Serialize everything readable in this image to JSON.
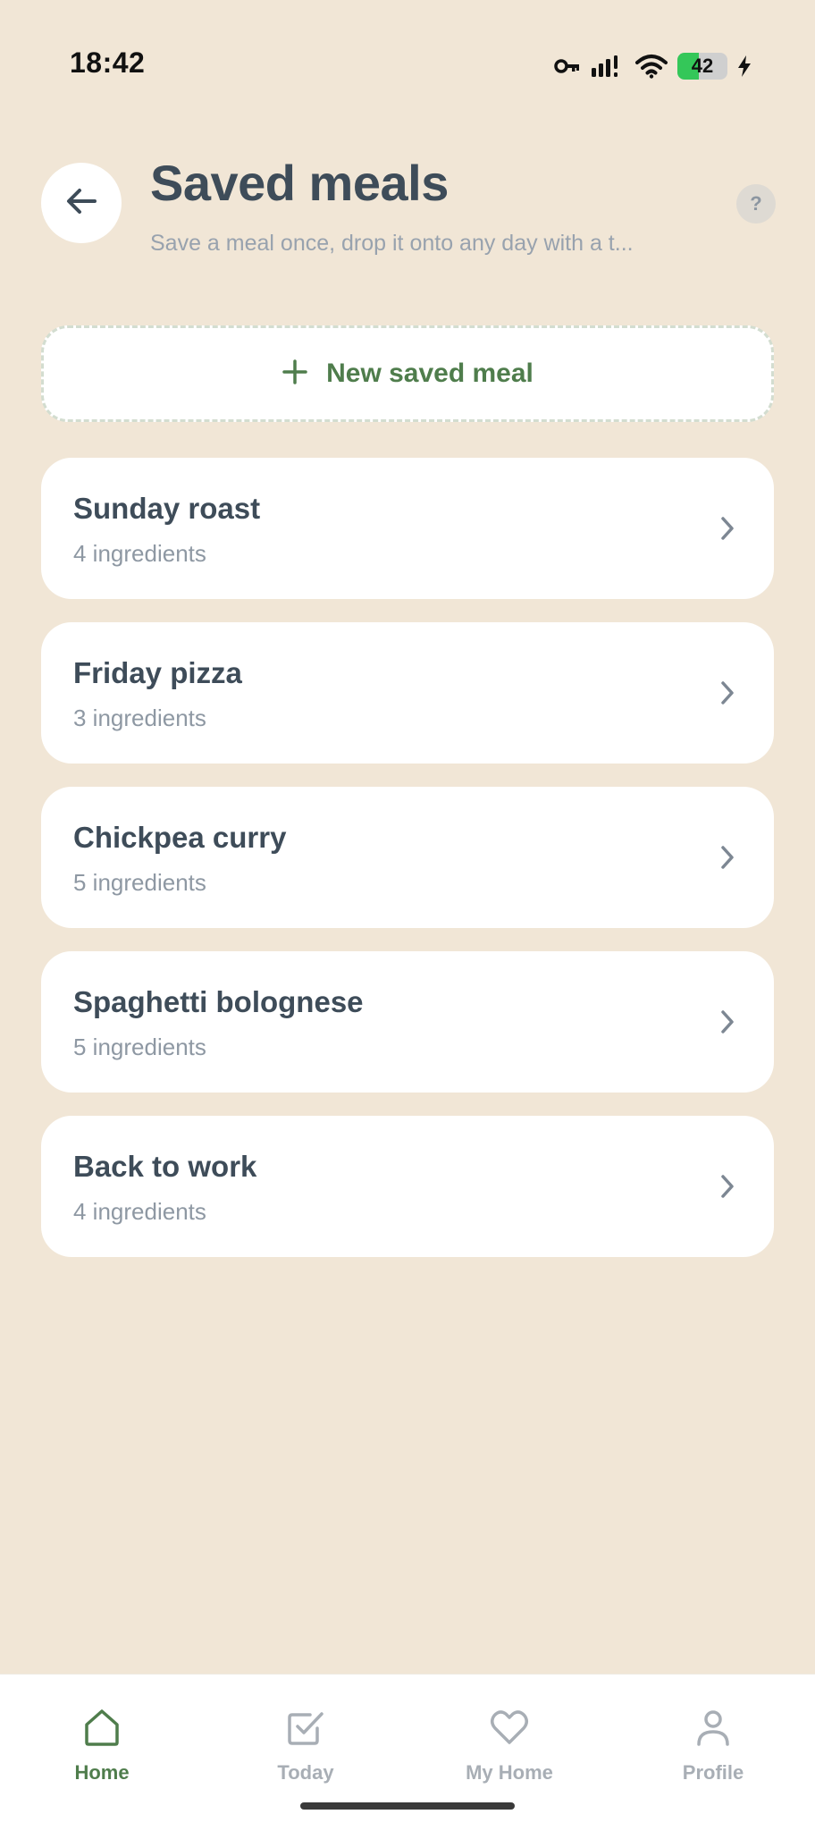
{
  "status_bar": {
    "time": "18:42",
    "battery_level": "42",
    "battery_fraction": 0.42,
    "icons": [
      "key-icon",
      "signal-icon",
      "wifi-icon",
      "battery-icon",
      "charging-bolt-icon"
    ]
  },
  "header": {
    "back_icon": "arrow-left-icon",
    "title": "Saved meals",
    "subtitle": "Save a meal once, drop it onto any day with a t...",
    "help_label": "?"
  },
  "new_meal_button": {
    "icon": "plus-icon",
    "label": "New saved meal"
  },
  "meals": [
    {
      "name": "Sunday roast",
      "count": "4 ingredients"
    },
    {
      "name": "Friday pizza",
      "count": "3 ingredients"
    },
    {
      "name": "Chickpea curry",
      "count": "5 ingredients"
    },
    {
      "name": "Spaghetti bolognese",
      "count": "5 ingredients"
    },
    {
      "name": "Back to work",
      "count": "4 ingredients"
    }
  ],
  "tab_bar": {
    "active": "Home",
    "tabs": [
      {
        "label": "Home",
        "icon": "home-icon"
      },
      {
        "label": "Today",
        "icon": "checkbox-icon"
      },
      {
        "label": "My Home",
        "icon": "heart-icon"
      },
      {
        "label": "Profile",
        "icon": "user-icon"
      }
    ]
  },
  "colors": {
    "background": "#F1E6D6",
    "card": "#FFFFFF",
    "accent_green": "#4F7D4C",
    "title_text": "#3E4C59",
    "muted_text": "#8E98A3"
  }
}
